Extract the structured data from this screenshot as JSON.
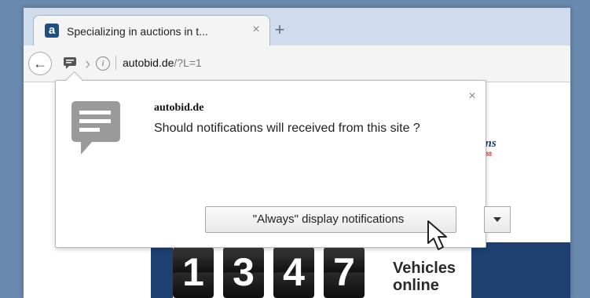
{
  "browser": {
    "tab": {
      "favicon_icon": "autobid-favicon",
      "title": "Specializing in auctions in t...",
      "close_symbol": "×"
    },
    "new_tab_symbol": "+",
    "toolbar": {
      "back_icon": "back-arrow-icon",
      "notification_icon": "notification-chat-icon",
      "info_symbol": "i",
      "url_host": "autobid.de",
      "url_path": "/?L=1"
    }
  },
  "popup": {
    "site": "autobid.de",
    "message": "Should notifications will received from this site ?",
    "close_symbol": "×",
    "select_value": "\"Always\" display notifications",
    "icon": "message-bubble-icon"
  },
  "page": {
    "logo_text": "ons",
    "logo_sub": "1988",
    "counter_digits": [
      "1",
      "3",
      "4",
      "7"
    ],
    "counter_label_line1": "Vehicles",
    "counter_label_line2": "online"
  },
  "colors": {
    "accent_blue": "#1d4070",
    "background": "#6a89ae"
  }
}
